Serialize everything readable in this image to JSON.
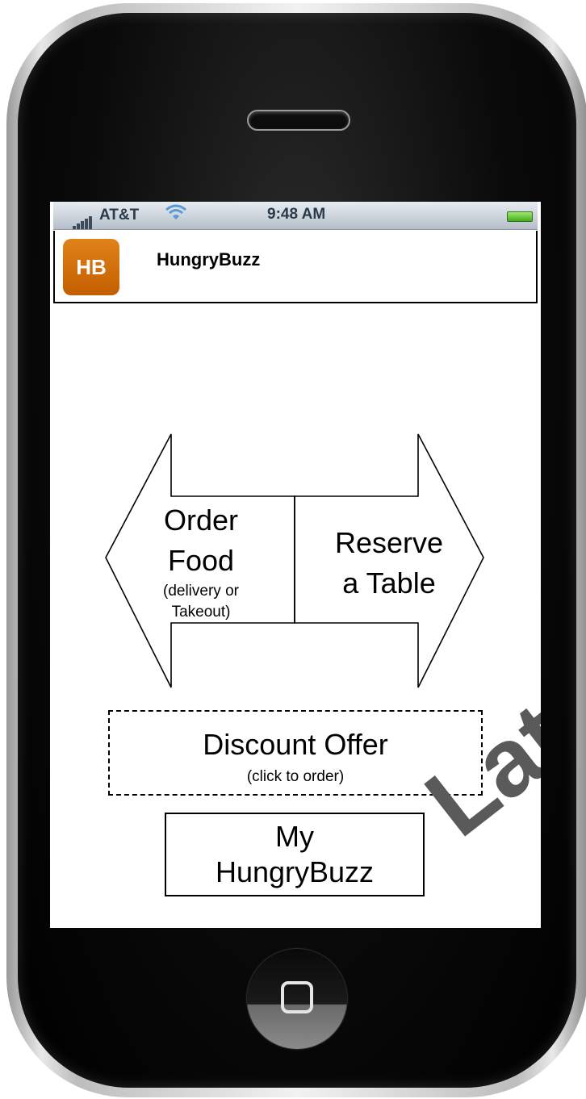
{
  "status_bar": {
    "carrier": "AT&T",
    "time": "9:48 AM",
    "signal_icon": "signal-bars-icon",
    "wifi_icon": "wifi-icon",
    "battery_icon": "battery-icon"
  },
  "header": {
    "logo_text": "HB",
    "app_title": "HungryBuzz"
  },
  "actions": {
    "order_title_line1": "Order",
    "order_title_line2": "Food",
    "order_sub_line1": "(delivery or",
    "order_sub_line2": "Takeout)",
    "reserve_line1": "Reserve",
    "reserve_line2": "a Table"
  },
  "discount": {
    "title": "Discount Offer",
    "subtitle": "(click to order)"
  },
  "my_hungrybuzz": {
    "line1": "My",
    "line2": "HungryBuzz"
  },
  "watermark": "Later",
  "colors": {
    "logo": "#d4700c",
    "status_bar": "#c8d0d8",
    "watermark": "#5a5a5a"
  }
}
